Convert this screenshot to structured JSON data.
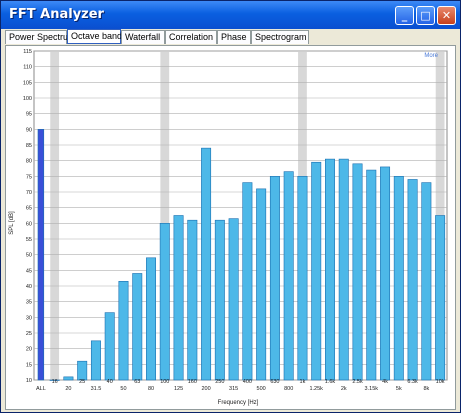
{
  "window": {
    "title": "FFT Analyzer"
  },
  "tabs": [
    {
      "label": "Power Spectrum",
      "active": false
    },
    {
      "label": "Octave band",
      "active": true
    },
    {
      "label": "Waterfall",
      "active": false
    },
    {
      "label": "Correlation",
      "active": false
    },
    {
      "label": "Phase",
      "active": false
    },
    {
      "label": "Spectrogram",
      "active": false
    }
  ],
  "more_label": "More",
  "colors": {
    "bar": "#4db8e8",
    "bar_edge": "#1a6fb0",
    "all_bar": "#3a4fd8",
    "band_highlight": "#d8d8d8"
  },
  "chart_data": {
    "type": "bar",
    "title": "",
    "xlabel": "Frequency [Hz]",
    "ylabel": "SPL [dB]",
    "ylim": [
      10,
      115
    ],
    "yticks": [
      10,
      15,
      20,
      25,
      30,
      35,
      40,
      45,
      50,
      55,
      60,
      65,
      70,
      75,
      80,
      85,
      90,
      95,
      100,
      105,
      110,
      115
    ],
    "categories": [
      "ALL",
      "16",
      "20",
      "25",
      "31.5",
      "40",
      "50",
      "63",
      "80",
      "100",
      "125",
      "160",
      "200",
      "250",
      "315",
      "400",
      "500",
      "630",
      "800",
      "1k",
      "1.25k",
      "1.6k",
      "2k",
      "2.5k",
      "3.15k",
      "4k",
      "5k",
      "6.3k",
      "8k",
      "10k"
    ],
    "values": [
      90,
      10,
      11,
      16,
      22.5,
      31.5,
      41.5,
      44,
      49,
      60,
      62.5,
      61,
      84,
      61,
      61.5,
      73,
      71,
      75,
      76.5,
      75,
      79.5,
      80.5,
      80.5,
      79,
      77,
      78,
      75,
      74,
      73,
      62.5
    ],
    "highlighted_categories": [
      "16",
      "100",
      "1k",
      "10k"
    ]
  }
}
